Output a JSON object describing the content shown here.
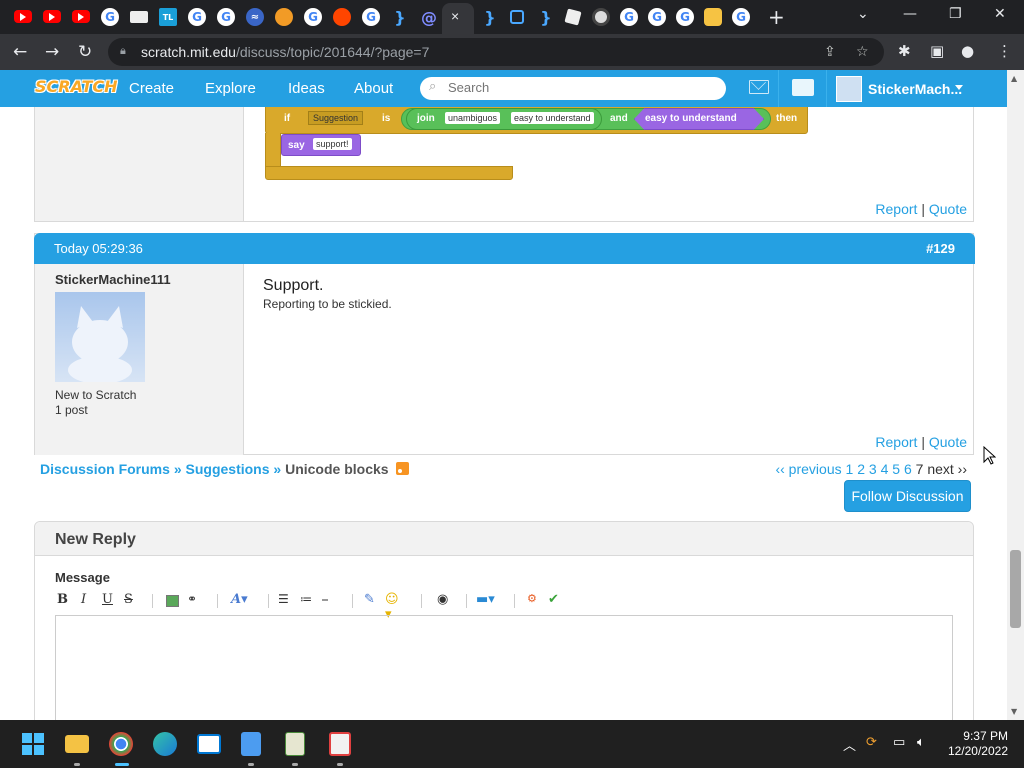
{
  "browser": {
    "url_host": "scratch.mit.edu",
    "url_path": "/discuss/topic/201644/?page=7",
    "new_tab": "+",
    "tab_close": "×"
  },
  "nav": {
    "logo": "SCRATCH",
    "links": [
      "Create",
      "Explore",
      "Ideas",
      "About"
    ],
    "search_placeholder": "Search",
    "username": "StickerMach..."
  },
  "prev_post": {
    "blocks": {
      "if": "if",
      "suggestion_dropdown": "Suggestion",
      "is": "is",
      "join": "join",
      "join_a": "unambiguos",
      "join_b": "easy to understand",
      "and": "and",
      "and_right": "easy to understand",
      "then": "then",
      "say": "say",
      "say_value": "support!"
    },
    "report": "Report",
    "quote": "Quote",
    "separator": "|"
  },
  "post": {
    "time": "Today 05:29:36",
    "number": "#129",
    "author": "StickerMachine111",
    "rank": "New to Scratch",
    "posts": "1 post",
    "title_text": "Support.",
    "body": "Reporting to be stickied.",
    "report": "Report",
    "quote": "Quote",
    "separator": "|"
  },
  "breadcrumb": {
    "forums": "Discussion Forums",
    "sep": "»",
    "category": "Suggestions",
    "topic": "Unicode blocks"
  },
  "pager": {
    "previous": "‹‹ previous",
    "pages": [
      "1",
      "2",
      "3",
      "4",
      "5",
      "6"
    ],
    "current": "7",
    "next": "next ››"
  },
  "follow_button": "Follow Discussion",
  "reply": {
    "title": "New Reply",
    "message_label": "Message",
    "bold": "B",
    "italic": "I",
    "underline": "U",
    "strike": "S"
  },
  "taskbar": {
    "time": "9:37 PM",
    "date": "12/20/2022"
  }
}
